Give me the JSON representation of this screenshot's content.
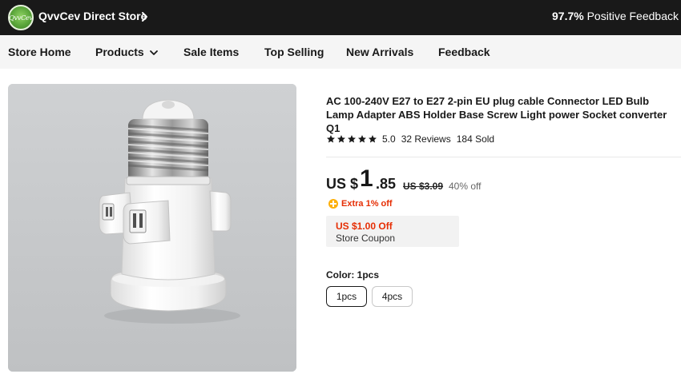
{
  "store": {
    "logo_text": "QvvCev",
    "name": "QvvCev Direct Store",
    "feedback_value": "97.7%",
    "feedback_label": "Positive Feedback"
  },
  "nav": {
    "items": [
      {
        "label": "Store Home"
      },
      {
        "label": "Products",
        "has_dropdown": true
      },
      {
        "label": "Sale Items"
      },
      {
        "label": "Top Selling"
      },
      {
        "label": "New Arrivals"
      },
      {
        "label": "Feedback"
      }
    ]
  },
  "product": {
    "title": "AC 100-240V E27 to E27 2-pin EU plug cable Connector LED Bulb Lamp Adapter ABS Holder Base Screw Light power Socket converter Q1",
    "rating": 5.0,
    "rating_text": "5.0",
    "reviews": "32 Reviews",
    "sold": "184 Sold",
    "price": {
      "currency": "US $",
      "integer": "1",
      "decimal": ".85",
      "original": "US $3.09",
      "discount": "40% off"
    },
    "extra_discount": "Extra 1% off",
    "coupon": {
      "amount": "US $1.00 Off",
      "label": "Store Coupon"
    },
    "color_label": "Color: 1pcs",
    "options": [
      {
        "label": "1pcs",
        "selected": true
      },
      {
        "label": "4pcs",
        "selected": false
      }
    ]
  },
  "colors": {
    "header_bg": "#191919",
    "nav_bg": "#f5f5f5",
    "accent_red": "#e62e04",
    "coin_yellow": "#fdb00b"
  },
  "icons": {
    "store_chevron": "chevron-right-icon",
    "nav_dropdown": "chevron-down-icon",
    "star": "star-icon",
    "extra_discount": "coin-plus-icon"
  }
}
